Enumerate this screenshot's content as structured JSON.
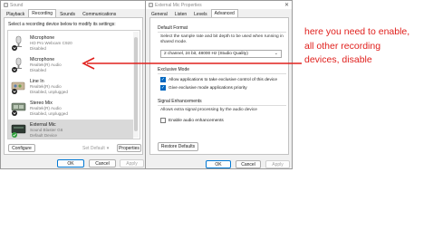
{
  "sound_window": {
    "title": "Sound",
    "tabs": [
      "Playback",
      "Recording",
      "Sounds",
      "Communications"
    ],
    "active_tab": "Recording",
    "instruction": "Select a recording device below to modify its settings:",
    "devices": [
      {
        "name": "Microphone",
        "line1": "HD Pro Webcam C920",
        "line2": "Disabled",
        "icon": "microphone-down-icon",
        "selected": false
      },
      {
        "name": "Microphone",
        "line1": "Realtek(R) Audio",
        "line2": "Disabled",
        "icon": "microphone-down-icon",
        "selected": false
      },
      {
        "name": "Line In",
        "line1": "Realtek(R) Audio",
        "line2": "Disabled, unplugged",
        "icon": "line-in-icon",
        "selected": false
      },
      {
        "name": "Stereo Mix",
        "line1": "Realtek(R) Audio",
        "line2": "Disabled, unplugged",
        "icon": "stereo-mix-icon",
        "selected": false
      },
      {
        "name": "External Mic",
        "line1": "Sound Blaster G6",
        "line2": "Default Device",
        "icon": "sound-card-icon",
        "selected": true
      }
    ],
    "buttons": {
      "configure": "Configure",
      "set_default": "Set Default",
      "properties": "Properties",
      "ok": "OK",
      "cancel": "Cancel",
      "apply": "Apply"
    }
  },
  "props_window": {
    "title": "External Mic Properties",
    "tabs": [
      "General",
      "Listen",
      "Levels",
      "Advanced"
    ],
    "active_tab": "Advanced",
    "default_format": {
      "heading": "Default Format",
      "description": "Select the sample rate and bit depth to be used when running in shared mode.",
      "selected": "2 channel, 24 bit, 48000 Hz (Studio Quality)"
    },
    "exclusive_mode": {
      "heading": "Exclusive Mode",
      "options": [
        {
          "label": "Allow applications to take exclusive control of this device",
          "checked": true
        },
        {
          "label": "Give exclusive mode applications priority",
          "checked": true
        }
      ]
    },
    "signal_enhancements": {
      "heading": "Signal Enhancements",
      "description": "Allows extra signal processing by the audio device",
      "option": {
        "label": "Enable audio enhancements",
        "checked": false
      }
    },
    "buttons": {
      "restore_defaults": "Restore Defaults",
      "ok": "OK",
      "cancel": "Cancel",
      "apply": "Apply"
    }
  },
  "annotation": {
    "lines": [
      "here you need to enable,",
      "all other recording",
      "devices, disable"
    ],
    "color": "#e0201d"
  }
}
